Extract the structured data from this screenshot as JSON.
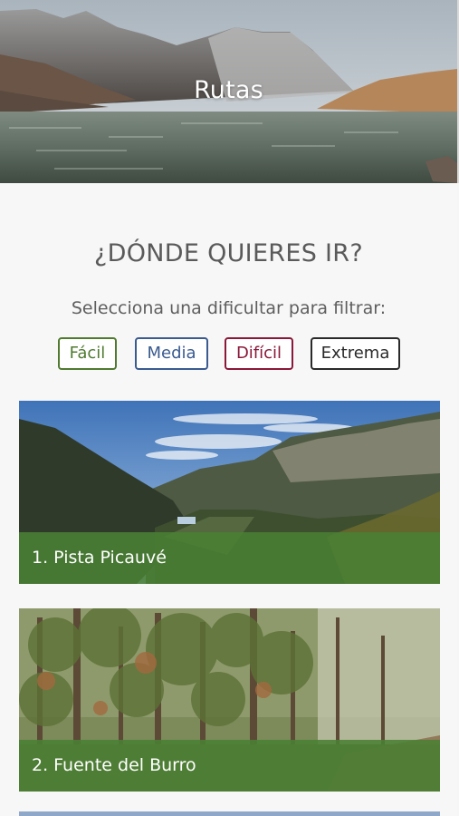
{
  "hero": {
    "title": "Rutas"
  },
  "section": {
    "heading": "¿DÓNDE QUIERES IR?",
    "subheading": "Selecciona una dificultar para filtrar:"
  },
  "filters": [
    {
      "label": "Fácil",
      "color": "#4f7a2f"
    },
    {
      "label": "Media",
      "color": "#3a5b8f"
    },
    {
      "label": "Difícil",
      "color": "#8a1838"
    },
    {
      "label": "Extrema",
      "color": "#2a2a2a"
    }
  ],
  "routes": [
    {
      "label": "1. Pista Picauvé"
    },
    {
      "label": "2. Fuente del Burro"
    }
  ],
  "colors": {
    "card_label_bg": "#4a8034"
  }
}
